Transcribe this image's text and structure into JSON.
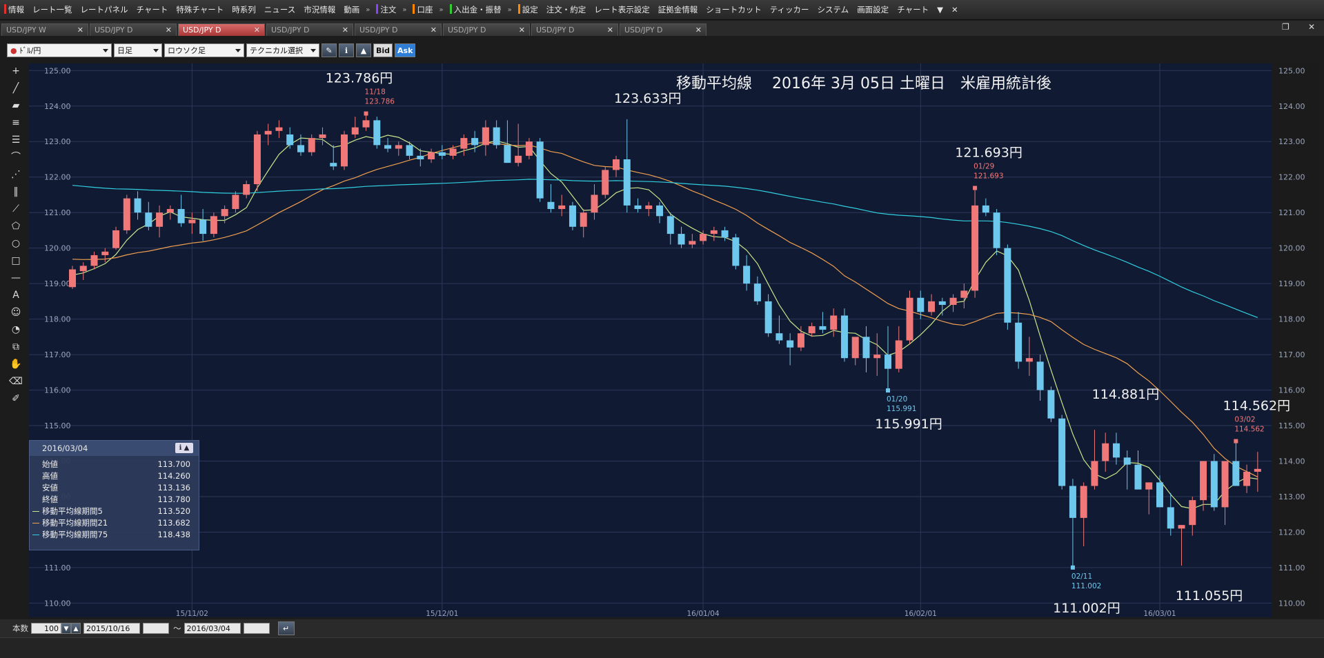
{
  "menu": {
    "items": [
      {
        "label": "情報",
        "marker": "#e03030"
      },
      {
        "label": "レート一覧"
      },
      {
        "label": "レートパネル"
      },
      {
        "label": "チャート"
      },
      {
        "label": "特殊チャート"
      },
      {
        "label": "時系列"
      },
      {
        "label": "ニュース"
      },
      {
        "label": "市況情報"
      },
      {
        "label": "動画"
      },
      {
        "label": "注文",
        "marker": "#8844ff",
        "sep": true
      },
      {
        "label": "口座",
        "marker": "#ff8800",
        "sep": true
      },
      {
        "label": "入出金・振替",
        "marker": "#33cc33",
        "sep": true
      },
      {
        "label": "設定",
        "marker": "#ff8800",
        "sep": true
      },
      {
        "label": "注文・約定"
      },
      {
        "label": "レート表示設定"
      },
      {
        "label": "証拠金情報"
      },
      {
        "label": "ショートカット"
      },
      {
        "label": "ティッカー"
      },
      {
        "label": "システム"
      },
      {
        "label": "画面設定"
      },
      {
        "label": "チャート"
      }
    ],
    "more_icon": "▼",
    "close_icon": "✕"
  },
  "tabs": [
    {
      "label": "USD/JPY W",
      "active": false
    },
    {
      "label": "USD/JPY D",
      "active": false
    },
    {
      "label": "USD/JPY D",
      "active": true
    },
    {
      "label": "USD/JPY D",
      "active": false
    },
    {
      "label": "USD/JPY D",
      "active": false
    },
    {
      "label": "USD/JPY D",
      "active": false
    },
    {
      "label": "USD/JPY D",
      "active": false
    },
    {
      "label": "USD/JPY D",
      "active": false
    }
  ],
  "toolbar": {
    "pair": "ﾄﾞﾙ/円",
    "period": "日足",
    "chart_type": "ロウソク足",
    "technical": "テクニカル選択",
    "bid": "Bid",
    "ask": "Ask"
  },
  "infobox": {
    "date": "2016/03/04",
    "rows": [
      {
        "label": "始値",
        "value": "113.700"
      },
      {
        "label": "高値",
        "value": "114.260"
      },
      {
        "label": "安値",
        "value": "113.136"
      },
      {
        "label": "終値",
        "value": "113.780"
      },
      {
        "label": "移動平均線期間5",
        "value": "113.520",
        "color": "#c8e68c"
      },
      {
        "label": "移動平均線期間21",
        "value": "113.682",
        "color": "#f0a050"
      },
      {
        "label": "移動平均線期間75",
        "value": "118.438",
        "color": "#30d0e0"
      }
    ]
  },
  "bottom": {
    "count_label": "本数",
    "count_value": "100",
    "from_date": "2015/10/16",
    "tilde": "～",
    "to_date": "2016/03/04"
  },
  "chart_data": {
    "type": "candlestick",
    "title": "移動平均線　 2016年 3月 05日 土曜日　米雇用統計後",
    "ylim": [
      110,
      125
    ],
    "y_ticks": [
      "110.00",
      "111.00",
      "112.00",
      "113.00",
      "114.00",
      "115.00",
      "116.00",
      "117.00",
      "118.00",
      "119.00",
      "120.00",
      "121.00",
      "122.00",
      "123.00",
      "124.00",
      "125.00"
    ],
    "x_ticks": [
      {
        "label": "15/11/02",
        "x": 10
      },
      {
        "label": "15/12/01",
        "x": 31
      },
      {
        "label": "16/01/04",
        "x": 53
      },
      {
        "label": "16/02/01",
        "x": 72
      },
      {
        "label": "16/03/01",
        "x": 92
      }
    ],
    "candles": [
      [
        118.9,
        119.5,
        118.85,
        119.4
      ],
      [
        119.35,
        119.6,
        119.1,
        119.5
      ],
      [
        119.5,
        119.9,
        119.4,
        119.8
      ],
      [
        119.8,
        120.0,
        119.6,
        119.9
      ],
      [
        120.0,
        120.6,
        119.95,
        120.5
      ],
      [
        120.5,
        121.5,
        120.4,
        121.4
      ],
      [
        121.4,
        121.6,
        120.8,
        121.0
      ],
      [
        121.0,
        121.3,
        120.5,
        120.6
      ],
      [
        120.6,
        121.2,
        120.3,
        121.0
      ],
      [
        121.0,
        121.2,
        120.8,
        121.1
      ],
      [
        121.1,
        121.5,
        120.6,
        120.7
      ],
      [
        120.7,
        121.0,
        120.4,
        120.8
      ],
      [
        120.8,
        121.1,
        120.2,
        120.4
      ],
      [
        120.4,
        121.0,
        120.3,
        120.9
      ],
      [
        120.9,
        121.2,
        120.7,
        121.1
      ],
      [
        121.1,
        121.6,
        121.0,
        121.5
      ],
      [
        121.5,
        121.9,
        121.4,
        121.8
      ],
      [
        121.8,
        123.3,
        121.6,
        123.2
      ],
      [
        123.2,
        123.5,
        122.9,
        123.3
      ],
      [
        123.3,
        123.6,
        123.1,
        123.4
      ],
      [
        123.2,
        123.4,
        122.8,
        122.9
      ],
      [
        122.9,
        123.2,
        122.6,
        122.7
      ],
      [
        122.7,
        123.2,
        122.6,
        123.1
      ],
      [
        123.1,
        123.4,
        122.9,
        123.2
      ],
      [
        122.4,
        122.9,
        122.2,
        122.3
      ],
      [
        122.3,
        123.3,
        122.2,
        123.2
      ],
      [
        123.2,
        123.7,
        123.1,
        123.4
      ],
      [
        123.4,
        123.79,
        123.3,
        123.6
      ],
      [
        123.6,
        123.7,
        122.8,
        122.9
      ],
      [
        122.9,
        123.1,
        122.7,
        122.8
      ],
      [
        122.8,
        123.0,
        122.6,
        122.9
      ],
      [
        122.9,
        123.0,
        122.5,
        122.6
      ],
      [
        122.6,
        122.8,
        122.3,
        122.5
      ],
      [
        122.5,
        122.8,
        122.4,
        122.7
      ],
      [
        122.7,
        122.9,
        122.5,
        122.6
      ],
      [
        122.6,
        122.9,
        122.5,
        122.8
      ],
      [
        122.8,
        123.2,
        122.6,
        123.1
      ],
      [
        123.1,
        123.3,
        122.7,
        122.9
      ],
      [
        122.9,
        123.6,
        122.6,
        123.4
      ],
      [
        123.4,
        123.6,
        122.8,
        122.9
      ],
      [
        122.9,
        123.6,
        122.6,
        122.4
      ],
      [
        122.4,
        123.5,
        122.3,
        122.6
      ],
      [
        122.6,
        123.1,
        122.5,
        123.0
      ],
      [
        123.0,
        123.1,
        121.3,
        121.4
      ],
      [
        121.3,
        121.8,
        121.0,
        121.1
      ],
      [
        121.1,
        121.5,
        120.9,
        121.2
      ],
      [
        121.2,
        121.3,
        120.5,
        120.6
      ],
      [
        120.6,
        121.1,
        120.3,
        121.0
      ],
      [
        121.0,
        121.8,
        120.8,
        121.5
      ],
      [
        121.5,
        122.3,
        121.4,
        122.2
      ],
      [
        122.2,
        122.6,
        122.0,
        122.5
      ],
      [
        122.5,
        123.63,
        121.0,
        121.2
      ],
      [
        121.2,
        121.4,
        121.0,
        121.1
      ],
      [
        121.1,
        121.3,
        120.9,
        121.2
      ],
      [
        121.2,
        121.3,
        120.7,
        120.9
      ],
      [
        120.9,
        121.0,
        120.1,
        120.4
      ],
      [
        120.4,
        120.6,
        120.0,
        120.1
      ],
      [
        120.1,
        120.4,
        120.0,
        120.2
      ],
      [
        120.2,
        120.5,
        120.1,
        120.4
      ],
      [
        120.4,
        120.6,
        120.2,
        120.5
      ],
      [
        120.5,
        120.6,
        120.2,
        120.3
      ],
      [
        120.3,
        120.4,
        119.4,
        119.5
      ],
      [
        119.5,
        119.8,
        118.8,
        119.0
      ],
      [
        119.0,
        119.2,
        118.4,
        118.5
      ],
      [
        118.5,
        118.7,
        117.5,
        117.6
      ],
      [
        117.6,
        118.1,
        117.3,
        117.4
      ],
      [
        117.4,
        117.6,
        116.7,
        117.2
      ],
      [
        117.2,
        117.8,
        117.1,
        117.6
      ],
      [
        117.6,
        117.9,
        117.5,
        117.8
      ],
      [
        117.8,
        118.2,
        117.6,
        117.7
      ],
      [
        117.7,
        118.3,
        117.5,
        118.1
      ],
      [
        118.1,
        118.3,
        116.8,
        116.9
      ],
      [
        116.9,
        117.4,
        116.7,
        117.5
      ],
      [
        117.5,
        117.8,
        116.5,
        116.9
      ],
      [
        116.9,
        117.6,
        116.4,
        117.0
      ],
      [
        117.0,
        117.8,
        115.99,
        116.6
      ],
      [
        116.6,
        117.8,
        116.5,
        117.4
      ],
      [
        117.4,
        118.8,
        117.3,
        118.6
      ],
      [
        118.6,
        118.8,
        118.0,
        118.2
      ],
      [
        118.2,
        118.7,
        118.1,
        118.5
      ],
      [
        118.5,
        118.6,
        118.1,
        118.4
      ],
      [
        118.4,
        118.7,
        118.2,
        118.6
      ],
      [
        118.6,
        119.0,
        118.3,
        118.8
      ],
      [
        118.8,
        121.693,
        118.6,
        121.2
      ],
      [
        121.2,
        121.4,
        120.9,
        121.0
      ],
      [
        121.0,
        121.1,
        119.8,
        120.0
      ],
      [
        120.0,
        120.1,
        117.7,
        117.9
      ],
      [
        117.9,
        118.2,
        116.6,
        116.8
      ],
      [
        116.8,
        117.5,
        116.4,
        116.9
      ],
      [
        116.8,
        117.0,
        115.7,
        116.0
      ],
      [
        116.0,
        116.1,
        115.1,
        115.2
      ],
      [
        115.2,
        115.3,
        113.2,
        113.3
      ],
      [
        113.3,
        113.5,
        111.002,
        112.4
      ],
      [
        112.4,
        113.4,
        111.6,
        113.3
      ],
      [
        113.3,
        114.881,
        113.2,
        114.0
      ],
      [
        114.0,
        114.8,
        113.7,
        114.5
      ],
      [
        114.5,
        114.8,
        113.9,
        114.1
      ],
      [
        114.1,
        114.3,
        113.2,
        113.9
      ],
      [
        113.9,
        114.3,
        113.4,
        113.2
      ],
      [
        113.2,
        113.4,
        112.5,
        113.4
      ],
      [
        113.4,
        113.6,
        112.8,
        112.7
      ],
      [
        112.7,
        113.1,
        111.9,
        112.1
      ],
      [
        112.1,
        112.2,
        111.055,
        112.2
      ],
      [
        112.2,
        113.0,
        111.9,
        112.9
      ],
      [
        112.9,
        114.0,
        112.6,
        114.0
      ],
      [
        114.0,
        114.2,
        112.6,
        112.7
      ],
      [
        112.7,
        114.0,
        112.2,
        114.0
      ],
      [
        114.0,
        114.562,
        113.3,
        113.3
      ],
      [
        113.3,
        113.9,
        113.1,
        113.7
      ],
      [
        113.7,
        114.26,
        113.136,
        113.78
      ]
    ],
    "ma_series": [
      {
        "name": "移動平均線期間5",
        "color": "#c8e68c"
      },
      {
        "name": "移動平均線期間21",
        "color": "#f0a050"
      },
      {
        "name": "移動平均線期間75",
        "color": "#30d0e0"
      }
    ],
    "peak_labels": [
      {
        "candle": 27,
        "date": "11/18",
        "value": "123.786",
        "pos": "above",
        "big": "123.786円",
        "big_dx": -10,
        "big_dy": -45
      },
      {
        "candle": 51,
        "big": "123.633円",
        "big_dx": 30,
        "big_dy": -24
      },
      {
        "candle": 83,
        "date": "01/29",
        "value": "121.693",
        "pos": "above",
        "big": "121.693円",
        "big_dx": 20,
        "big_dy": -45
      },
      {
        "candle": 75,
        "date": "01/20",
        "value": "115.991",
        "pos": "below",
        "big": "115.991円",
        "big_dx": 30,
        "big_dy": 55
      },
      {
        "candle": 92,
        "date": "02/11",
        "value": "111.002",
        "pos": "below",
        "big": "111.002円",
        "big_dx": 20,
        "big_dy": 65
      },
      {
        "candle": 94,
        "big": "114.881円",
        "big_dx": 45,
        "big_dy": -45
      },
      {
        "candle": 102,
        "big": "111.055円",
        "big_dx": 40,
        "big_dy": 50
      },
      {
        "candle": 107,
        "date": "03/02",
        "value": "114.562",
        "pos": "above",
        "big": "114.562円",
        "big_dx": 30,
        "big_dy": -45
      }
    ]
  }
}
